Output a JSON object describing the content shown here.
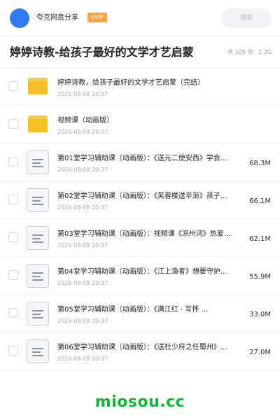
{
  "header": {
    "app_name": "夸克网盘分享",
    "badge": "SVIP",
    "search_placeholder": "搜索",
    "avatar_color": "#2f7cf6"
  },
  "share": {
    "title": "婷婷诗教-给孩子最好的文学才艺启蒙",
    "meta": "共 105 项 · 1.2G"
  },
  "items": [
    {
      "type": "folder",
      "name": "婷婷诗教，给孩子最好的文学才艺启蒙（完结）",
      "date": "2026-08-08 20:37",
      "size": ""
    },
    {
      "type": "folder",
      "name": "视频课（动画版）",
      "date": "2026-08-08 20:37",
      "size": ""
    },
    {
      "type": "file",
      "name": "第01堂学习辅助课（动画版）：《送元二使安西》学会…",
      "date": "2026-08-08 20:37",
      "size": "68.3M"
    },
    {
      "type": "file",
      "name": "第02堂学习辅助课（动画版）：《芙蓉楼送辛渐》孩子…",
      "date": "2026-08-08 20:37",
      "size": "66.1M"
    },
    {
      "type": "file",
      "name": "第03堂学习辅助课（动画版）：视频课《凉州词》热爱…",
      "date": "2026-08-08 20:37",
      "size": "62.1M"
    },
    {
      "type": "file",
      "name": "第04堂学习辅助课（动画版）：《江上渔者》想要守护…",
      "date": "2026-08-08 20:37",
      "size": "55.9M"
    },
    {
      "type": "file",
      "name": "第05堂学习辅助课（动画版）：《满江红 · 写怀 …",
      "date": "2026-08-08 20:37",
      "size": "33.0M"
    },
    {
      "type": "file",
      "name": "第06堂学习辅助课（动画版）：《送杜少府之任蜀州》…",
      "date": "2026-08-08 20:37",
      "size": "27.0M"
    }
  ],
  "watermark": "miosou.cc",
  "colors": {
    "folder": "#f5c025",
    "badge": "#f7a541",
    "watermark": "#16b33b"
  }
}
